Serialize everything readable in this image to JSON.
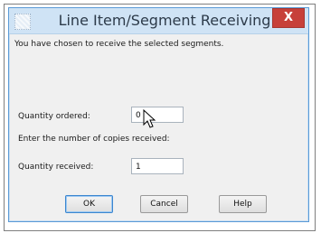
{
  "dialog": {
    "title": "Line Item/Segment Receiving",
    "close_label": "X",
    "message": "You have chosen to receive the selected segments.",
    "quantity_ordered_label": "Quantity ordered:",
    "quantity_ordered_value": "0",
    "copies_prompt": "Enter the number of copies received:",
    "quantity_received_label": "Quantity received:",
    "quantity_received_value": "1",
    "buttons": {
      "ok": "OK",
      "cancel": "Cancel",
      "help": "Help"
    }
  }
}
